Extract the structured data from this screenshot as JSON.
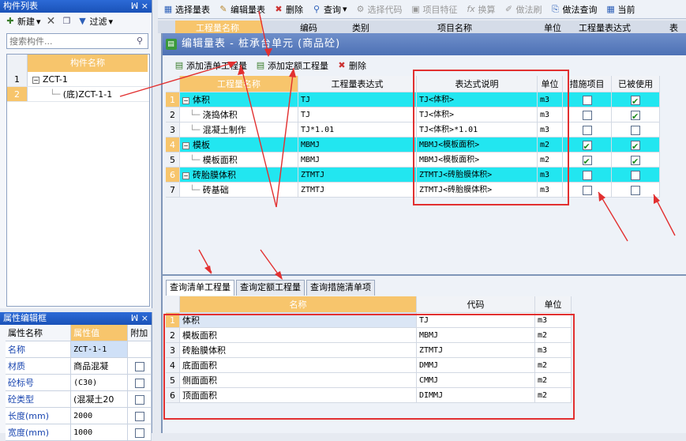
{
  "left_panel": {
    "title": "构件列表",
    "pin_icons": "ꟽ ×",
    "toolbar": {
      "new_label": "新建",
      "filter_label": "过滤"
    },
    "search": {
      "placeholder": "搜索构件..."
    },
    "tree": {
      "header": "构件名称",
      "rows": [
        {
          "num": "1",
          "label": "ZCT-1"
        },
        {
          "num": "2",
          "label": "(底)ZCT-1-1"
        }
      ]
    }
  },
  "prop_panel": {
    "title": "属性编辑框",
    "pin_icons": "ꟽ ×",
    "headers": {
      "name": "属性名称",
      "value": "属性值",
      "extra": "附加"
    },
    "rows": [
      {
        "name": "名称",
        "value": "ZCT-1-1",
        "check": false,
        "show_check": false
      },
      {
        "name": "材质",
        "value": "商品混凝",
        "check": false,
        "show_check": true
      },
      {
        "name": "砼标号",
        "value": "(C30)",
        "check": false,
        "show_check": true
      },
      {
        "name": "砼类型",
        "value": "(混凝土20",
        "check": false,
        "show_check": true
      },
      {
        "name": "长度(mm)",
        "value": "2000",
        "check": false,
        "show_check": true
      },
      {
        "name": "宽度(mm)",
        "value": "1000",
        "check": false,
        "show_check": true
      }
    ]
  },
  "top_toolbar": {
    "items": [
      "选择量表",
      "编辑量表",
      "删除",
      "查询",
      "选择代码",
      "项目特征",
      "换算",
      "做法刷",
      "做法查询",
      "当前"
    ]
  },
  "bg_header": {
    "col1": "工程量名称",
    "col2": "编码",
    "col3": "类别",
    "col4": "项目名称",
    "col5": "单位",
    "col6": "工程量表达式",
    "col7": "表达"
  },
  "dialog": {
    "title": "编辑量表 - 桩承台单元 (商品砼)",
    "toolbar": {
      "add_list": "添加清单工程量",
      "add_quota": "添加定额工程量",
      "delete": "删除"
    },
    "upper_grid": {
      "headers": [
        "工程量名称",
        "工程量表达式",
        "表达式说明",
        "单位",
        "措施项目",
        "已被使用"
      ],
      "rows": [
        {
          "num": "1",
          "name": "体积",
          "expr": "TJ",
          "desc": "TJ<体积>",
          "unit": "m3",
          "measure": false,
          "used": true,
          "group": true
        },
        {
          "num": "2",
          "name": "浇捣体积",
          "expr": "TJ",
          "desc": "TJ<体积>",
          "unit": "m3",
          "measure": false,
          "used": true,
          "group": false
        },
        {
          "num": "3",
          "name": "混凝土制作",
          "expr": "TJ*1.01",
          "desc": "TJ<体积>*1.01",
          "unit": "m3",
          "measure": false,
          "used": false,
          "group": false
        },
        {
          "num": "4",
          "name": "模板",
          "expr": "MBMJ",
          "desc": "MBMJ<模板面积>",
          "unit": "m2",
          "measure": true,
          "used": true,
          "group": true
        },
        {
          "num": "5",
          "name": "模板面积",
          "expr": "MBMJ",
          "desc": "MBMJ<模板面积>",
          "unit": "m2",
          "measure": true,
          "used": true,
          "group": false
        },
        {
          "num": "6",
          "name": "砖胎膜体积",
          "expr": "ZTMTJ",
          "desc": "ZTMTJ<砖胎膜体积>",
          "unit": "m3",
          "measure": false,
          "used": false,
          "group": true
        },
        {
          "num": "7",
          "name": "砖基础",
          "expr": "ZTMTJ",
          "desc": "ZTMTJ<砖胎膜体积>",
          "unit": "m3",
          "measure": false,
          "used": false,
          "group": false
        }
      ]
    },
    "bottom_tabs": [
      "查询清单工程量",
      "查询定额工程量",
      "查询措施清单项"
    ],
    "lower_grid": {
      "headers": [
        "名称",
        "代码",
        "单位"
      ],
      "rows": [
        {
          "num": "1",
          "name": "体积",
          "code": "TJ",
          "unit": "m3"
        },
        {
          "num": "2",
          "name": "模板面积",
          "code": "MBMJ",
          "unit": "m2"
        },
        {
          "num": "3",
          "name": "砖胎膜体积",
          "code": "ZTMTJ",
          "unit": "m3"
        },
        {
          "num": "4",
          "name": "底面面积",
          "code": "DMMJ",
          "unit": "m2"
        },
        {
          "num": "5",
          "name": "侧面面积",
          "code": "CMMJ",
          "unit": "m2"
        },
        {
          "num": "6",
          "name": "顶面面积",
          "code": "DIMMJ",
          "unit": "m2"
        }
      ]
    }
  },
  "colors": {
    "accent": "#f7c56c",
    "cyan_row": "#22e6f0",
    "annotation": "#e23030",
    "title_bar": "#2c6ad6"
  }
}
